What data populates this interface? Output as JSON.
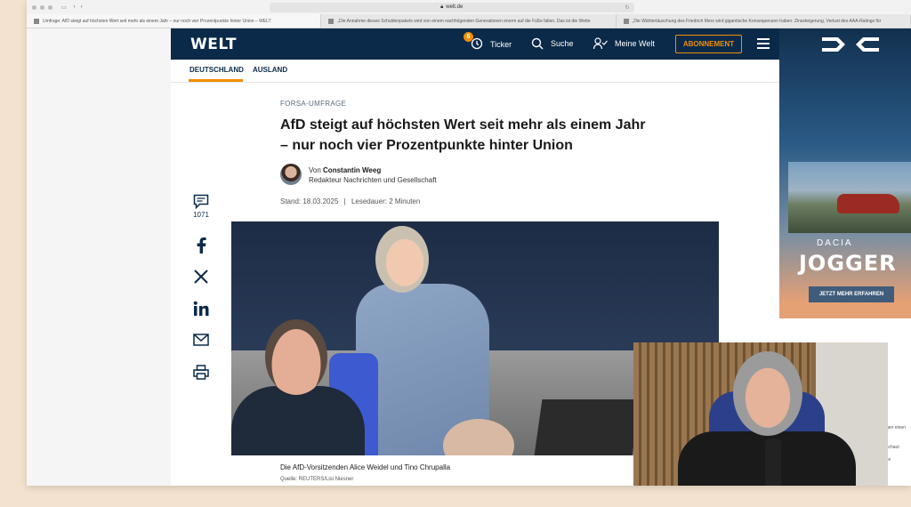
{
  "browser": {
    "url": "welt.de",
    "tabs": [
      {
        "label": "Umfrage: AfD steigt auf höchsten Wert seit mehr als einem Jahr – nur noch vier Prozentpunkte hinter Union – WELT"
      },
      {
        "label": "„Die Annahme dieses Schuldenpakets wird von einem nachfolgenden Generationen enorm auf die Füße fallen. Das ist die Wette"
      },
      {
        "label": "„Die Wählertäuschung des Friedrich Merz wird gigantische Konsequenzen haben: Zinssteigerung, Verlust des AAA-Ratings für"
      }
    ]
  },
  "header": {
    "logo": "WELT",
    "ticker_label": "Ticker",
    "ticker_badge": "6",
    "search_label": "Suche",
    "account_label": "Meine Welt",
    "subscribe_label": "ABONNEMENT"
  },
  "subnav": {
    "items": [
      {
        "label": "DEUTSCHLAND"
      },
      {
        "label": "AUSLAND"
      }
    ]
  },
  "article": {
    "kicker": "FORSA-UMFRAGE",
    "headline": "AfD steigt auf höchsten Wert seit mehr als einem Jahr – nur noch vier Prozentpunkte hinter Union",
    "author_prefix": "Von",
    "author_name": "Constantin Weeg",
    "author_role": "Redakteur Nachrichten und Gesellschaft",
    "date": "Stand: 18.03.2025",
    "separator": "|",
    "reading_time": "Lesedauer: 2 Minuten",
    "caption": "Die AfD-Vorsitzenden Alice Weidel und Tino Chrupalla",
    "source": "Quelle: REUTERS/Lisi Niesner"
  },
  "share": {
    "comment_count": "1071"
  },
  "ad": {
    "brand": "DACIA",
    "title": "JOGGER",
    "cta": "JETZT MEHR ERFAHREN",
    "frag1": "nen einen",
    "frag2": "schaut",
    "frag3": "ite"
  }
}
